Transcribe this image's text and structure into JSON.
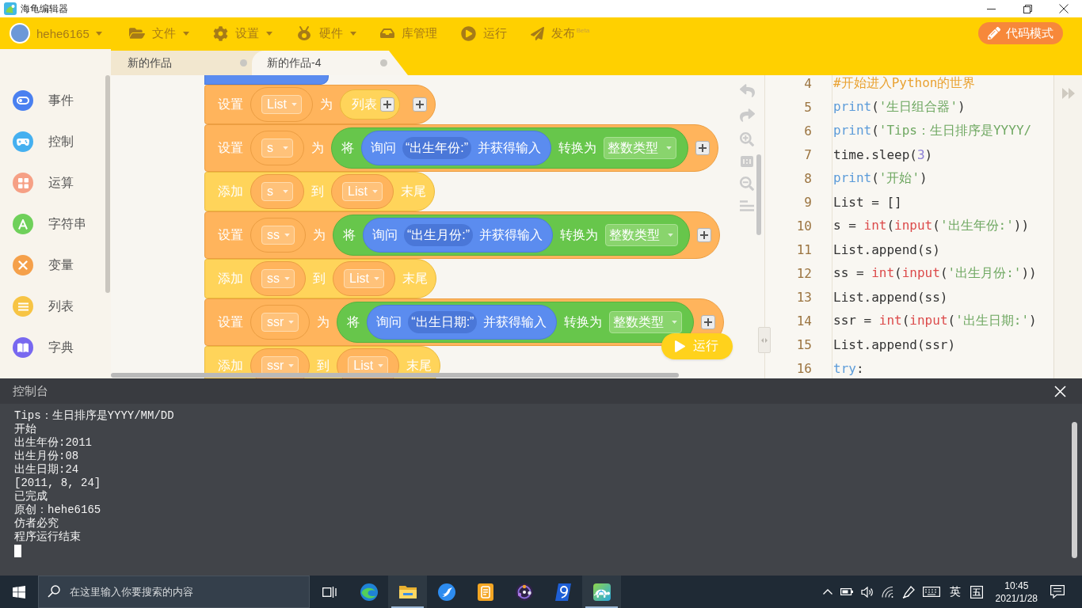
{
  "window": {
    "title": "海龟编辑器"
  },
  "toolbar": {
    "user": {
      "name": "hehe6165",
      "dropdown": true
    },
    "menus": [
      {
        "label": "文件",
        "dropdown": true
      },
      {
        "label": "设置",
        "dropdown": true
      },
      {
        "label": "硬件",
        "dropdown": true
      },
      {
        "label": "库管理",
        "dropdown": false
      },
      {
        "label": "运行",
        "dropdown": false
      },
      {
        "label": "发布",
        "dropdown": false,
        "badge": "Beta"
      }
    ],
    "mode_button": {
      "label": "代码模式"
    }
  },
  "tabs": [
    {
      "label": "新的作品",
      "selected": false
    },
    {
      "label": "新的作品-4",
      "selected": true
    }
  ],
  "sidebar": {
    "categories": [
      {
        "label": "事件",
        "color": "#4a80f0"
      },
      {
        "label": "控制",
        "color": "#45b0f0"
      },
      {
        "label": "运算",
        "color": "#f6a085"
      },
      {
        "label": "字符串",
        "color": "#6fd05a"
      },
      {
        "label": "变量",
        "color": "#f5a04a"
      },
      {
        "label": "列表",
        "color": "#f7c444"
      },
      {
        "label": "字典",
        "color": "#7868f0"
      }
    ]
  },
  "workspace": {
    "blocks": [
      {
        "kind": "set",
        "keyword": "设置",
        "variable": "List",
        "connector": "为",
        "value": {
          "kind": "list",
          "label": "列表"
        }
      },
      {
        "kind": "set",
        "keyword": "设置",
        "variable": "s",
        "connector": "为",
        "value": {
          "kind": "convert",
          "prefix": "将",
          "ask": "询问",
          "prompt": "“出生年份:”",
          "ask_suffix": "并获得输入",
          "infix": "转换为",
          "target": "整数类型"
        }
      },
      {
        "kind": "append",
        "keyword": "添加",
        "variable": "s",
        "connector": "到",
        "list": "List",
        "suffix": "末尾"
      },
      {
        "kind": "set",
        "keyword": "设置",
        "variable": "ss",
        "connector": "为",
        "value": {
          "kind": "convert",
          "prefix": "将",
          "ask": "询问",
          "prompt": "“出生月份:”",
          "ask_suffix": "并获得输入",
          "infix": "转换为",
          "target": "整数类型"
        }
      },
      {
        "kind": "append",
        "keyword": "添加",
        "variable": "ss",
        "connector": "到",
        "list": "List",
        "suffix": "末尾"
      },
      {
        "kind": "set",
        "keyword": "设置",
        "variable": "ssr",
        "connector": "为",
        "value": {
          "kind": "convert",
          "prefix": "将",
          "ask": "询问",
          "prompt": "“出生日期:”",
          "ask_suffix": "并获得输入",
          "infix": "转换为",
          "target": "整数类型"
        }
      },
      {
        "kind": "append",
        "keyword": "添加",
        "variable": "ssr",
        "connector": "到",
        "list": "List",
        "suffix": "末尾"
      }
    ],
    "run_button": {
      "label": "运行"
    }
  },
  "editor": {
    "lines": [
      {
        "number": "4",
        "tokens": [
          {
            "kind": "comment",
            "text": "#开始进入Python的世界"
          }
        ]
      },
      {
        "number": "5",
        "tokens": [
          {
            "kind": "builtin",
            "text": "print"
          },
          {
            "kind": "plain",
            "text": "("
          },
          {
            "kind": "string",
            "text": "'生日组合器'"
          },
          {
            "kind": "plain",
            "text": ")"
          }
        ]
      },
      {
        "number": "6",
        "tokens": [
          {
            "kind": "builtin",
            "text": "print"
          },
          {
            "kind": "plain",
            "text": "("
          },
          {
            "kind": "string",
            "text": "'Tips：生日排序是YYYY/"
          }
        ]
      },
      {
        "number": "7",
        "tokens": [
          {
            "kind": "plain",
            "text": "time.sleep("
          },
          {
            "kind": "number",
            "text": "3"
          },
          {
            "kind": "plain",
            "text": ")"
          }
        ]
      },
      {
        "number": "8",
        "tokens": [
          {
            "kind": "builtin",
            "text": "print"
          },
          {
            "kind": "plain",
            "text": "("
          },
          {
            "kind": "string",
            "text": "'开始'"
          },
          {
            "kind": "plain",
            "text": ")"
          }
        ]
      },
      {
        "number": "9",
        "tokens": [
          {
            "kind": "plain",
            "text": "List = []"
          }
        ]
      },
      {
        "number": "10",
        "tokens": [
          {
            "kind": "plain",
            "text": "s = "
          },
          {
            "kind": "function",
            "text": "int"
          },
          {
            "kind": "plain",
            "text": "("
          },
          {
            "kind": "function",
            "text": "input"
          },
          {
            "kind": "plain",
            "text": "("
          },
          {
            "kind": "string",
            "text": "'出生年份:'"
          },
          {
            "kind": "plain",
            "text": "))"
          }
        ]
      },
      {
        "number": "11",
        "tokens": [
          {
            "kind": "plain",
            "text": "List.append(s)"
          }
        ]
      },
      {
        "number": "12",
        "tokens": [
          {
            "kind": "plain",
            "text": "ss = "
          },
          {
            "kind": "function",
            "text": "int"
          },
          {
            "kind": "plain",
            "text": "("
          },
          {
            "kind": "function",
            "text": "input"
          },
          {
            "kind": "plain",
            "text": "("
          },
          {
            "kind": "string",
            "text": "'出生月份:'"
          },
          {
            "kind": "plain",
            "text": "))"
          }
        ]
      },
      {
        "number": "13",
        "tokens": [
          {
            "kind": "plain",
            "text": "List.append(ss)"
          }
        ]
      },
      {
        "number": "14",
        "tokens": [
          {
            "kind": "plain",
            "text": "ssr = "
          },
          {
            "kind": "function",
            "text": "int"
          },
          {
            "kind": "plain",
            "text": "("
          },
          {
            "kind": "function",
            "text": "input"
          },
          {
            "kind": "plain",
            "text": "("
          },
          {
            "kind": "string",
            "text": "'出生日期:'"
          },
          {
            "kind": "plain",
            "text": ")"
          }
        ]
      },
      {
        "number": "15",
        "tokens": [
          {
            "kind": "plain",
            "text": "List.append(ssr)"
          }
        ]
      },
      {
        "number": "16",
        "tokens": [
          {
            "kind": "keyword",
            "text": "try"
          },
          {
            "kind": "plain",
            "text": ":"
          }
        ]
      }
    ]
  },
  "console": {
    "title": "控制台",
    "lines": [
      "Tips：生日排序是YYYY/MM/DD",
      "开始",
      "出生年份:2011",
      "出生月份:08",
      "出生日期:24",
      "[2011, 8, 24]",
      "已完成",
      "原创：hehe6165",
      "仿者必究",
      "程序运行结束"
    ]
  },
  "taskbar": {
    "search": {
      "placeholder": "在这里输入你要搜索的内容"
    },
    "apps": [
      {
        "running": false
      },
      {
        "running": true
      },
      {
        "running": false
      },
      {
        "running": false
      },
      {
        "running": false
      },
      {
        "running": false
      },
      {
        "running": true
      }
    ],
    "tray": {
      "input_language": "英",
      "time": "10:45",
      "date": "2021/1/28"
    }
  }
}
